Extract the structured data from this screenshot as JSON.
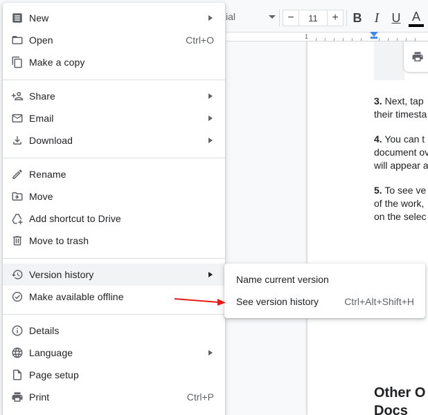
{
  "toolbar": {
    "font_name": "ial",
    "font_size": "11",
    "minus": "−",
    "plus": "+",
    "bold": "B",
    "italic": "I",
    "underline": "U",
    "text_color": "A"
  },
  "ruler": {
    "start_number": "1"
  },
  "file_menu": {
    "items": [
      {
        "label": "New",
        "shortcut": "",
        "submenu": true,
        "icon": "new-document-icon"
      },
      {
        "label": "Open",
        "shortcut": "Ctrl+O",
        "submenu": false,
        "icon": "folder-icon"
      },
      {
        "label": "Make a copy",
        "shortcut": "",
        "submenu": false,
        "icon": "copy-icon"
      },
      {
        "label": "Share",
        "shortcut": "",
        "submenu": true,
        "icon": "person-add-icon"
      },
      {
        "label": "Email",
        "shortcut": "",
        "submenu": true,
        "icon": "email-icon"
      },
      {
        "label": "Download",
        "shortcut": "",
        "submenu": true,
        "icon": "download-icon"
      },
      {
        "label": "Rename",
        "shortcut": "",
        "submenu": false,
        "icon": "pencil-icon"
      },
      {
        "label": "Move",
        "shortcut": "",
        "submenu": false,
        "icon": "move-folder-icon"
      },
      {
        "label": "Add shortcut to Drive",
        "shortcut": "",
        "submenu": false,
        "icon": "drive-shortcut-icon"
      },
      {
        "label": "Move to trash",
        "shortcut": "",
        "submenu": false,
        "icon": "trash-icon"
      },
      {
        "label": "Version history",
        "shortcut": "",
        "submenu": true,
        "icon": "history-icon"
      },
      {
        "label": "Make available offline",
        "shortcut": "",
        "submenu": false,
        "icon": "offline-check-icon"
      },
      {
        "label": "Details",
        "shortcut": "",
        "submenu": false,
        "icon": "info-icon"
      },
      {
        "label": "Language",
        "shortcut": "",
        "submenu": true,
        "icon": "globe-icon"
      },
      {
        "label": "Page setup",
        "shortcut": "",
        "submenu": false,
        "icon": "page-icon"
      },
      {
        "label": "Print",
        "shortcut": "Ctrl+P",
        "submenu": false,
        "icon": "printer-icon"
      }
    ]
  },
  "version_submenu": {
    "items": [
      {
        "label": "Name current version",
        "shortcut": ""
      },
      {
        "label": "See version history",
        "shortcut": "Ctrl+Alt+Shift+H"
      }
    ]
  },
  "document": {
    "paragraphs": [
      {
        "num": "3.",
        "lines": [
          " Next, tap",
          "their timesta"
        ]
      },
      {
        "num": "4.",
        "lines": [
          " You can t",
          "document ov",
          "will appear a"
        ]
      },
      {
        "num": "5.",
        "lines": [
          " To see ve",
          "of the work,",
          "on the selec"
        ]
      }
    ],
    "heading_lines": [
      "Other O",
      "Docs"
    ]
  },
  "colors": {
    "accent": "#4285f4",
    "annotation": "#e8191b",
    "highlight": "#f1f3f4"
  }
}
